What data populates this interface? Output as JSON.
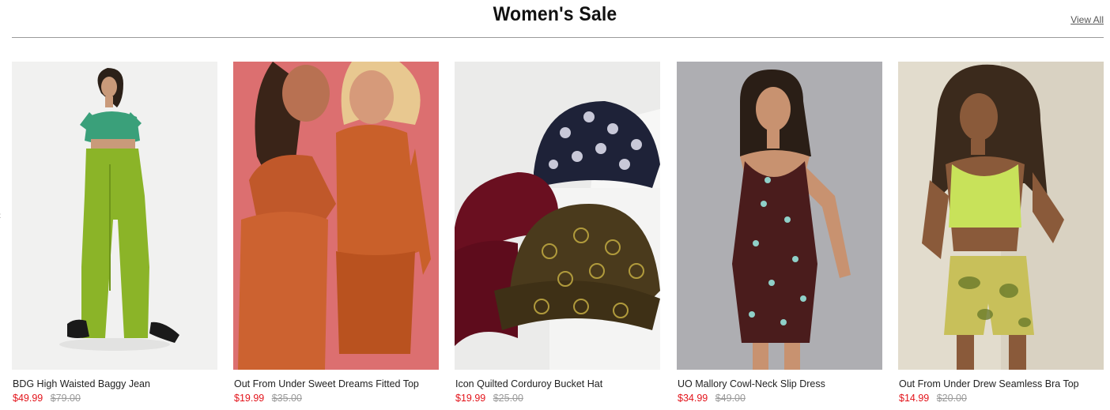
{
  "section": {
    "title": "Women's Sale",
    "view_all": "View All"
  },
  "products": [
    {
      "name": "BDG High Waisted Baggy Jean",
      "sale_price": "$49.99",
      "original_price": "$79.00",
      "image": "model-green-baggy-jeans"
    },
    {
      "name": "Out From Under Sweet Dreams Fitted Top",
      "sale_price": "$19.99",
      "original_price": "$35.00",
      "image": "two-models-orange-fitted-tops"
    },
    {
      "name": "Icon Quilted Corduroy Bucket Hat",
      "sale_price": "$19.99",
      "original_price": "$25.00",
      "image": "three-bucket-hats"
    },
    {
      "name": "UO Mallory Cowl-Neck Slip Dress",
      "sale_price": "$34.99",
      "original_price": "$49.00",
      "image": "model-butterfly-slip-dress"
    },
    {
      "name": "Out From Under Drew Seamless Bra Top",
      "sale_price": "$14.99",
      "original_price": "$20.00",
      "image": "model-lime-bra-top"
    }
  ],
  "colors": {
    "sale_price": "#e3141b",
    "original_price": "#9a9a9a",
    "rule": "#9a9a9a"
  }
}
